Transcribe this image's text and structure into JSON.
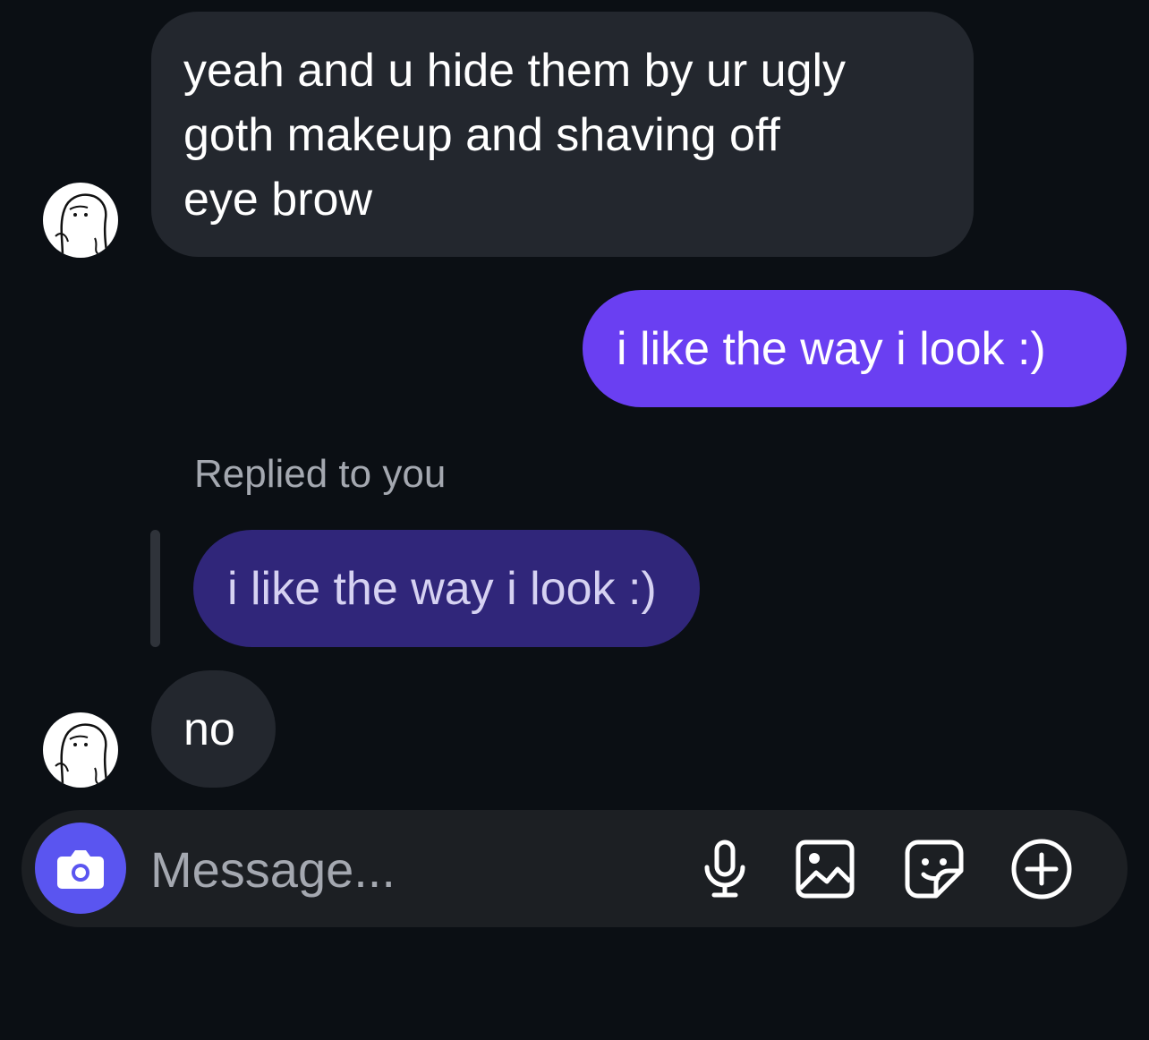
{
  "messages": [
    {
      "sender": "them",
      "lines": [
        "yeah and u hide them by ur ugly",
        "goth makeup and shaving off",
        "eye brow"
      ]
    },
    {
      "sender": "me",
      "text": "i like the way i look :)"
    },
    {
      "sender": "them",
      "reply_label": "Replied to you",
      "quoted_text": "i like the way i look :)",
      "text": "no"
    }
  ],
  "composer": {
    "placeholder": "Message..."
  },
  "icons": {
    "camera": "camera-icon",
    "mic": "microphone-icon",
    "gallery": "image-icon",
    "sticker": "sticker-icon",
    "add": "plus-circle-icon",
    "avatar": "cartoon-avatar"
  },
  "colors": {
    "background": "#0b0f14",
    "incoming_bubble": "#23272e",
    "outgoing_bubble": "#6a3ff2",
    "quoted_bubble": "#30267a",
    "composer": "#1c1f23",
    "camera_button": "#5a55f0",
    "muted_text": "#a4a8b0"
  }
}
